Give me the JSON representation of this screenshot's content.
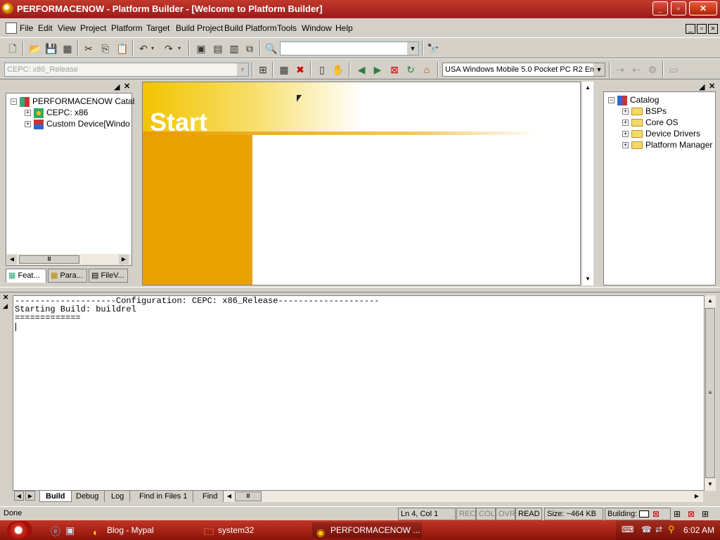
{
  "window": {
    "title": "PERFORMACENOW - Platform Builder - [Welcome to Platform Builder]",
    "minimize": "_",
    "maximize": "▫",
    "close": "✕"
  },
  "menu": [
    "File",
    "Edit",
    "View",
    "Project",
    "Platform",
    "Target",
    "Build Project",
    "Build Platform",
    "Tools",
    "Window",
    "Help"
  ],
  "toolbar": {
    "find_combo_value": "",
    "config_combo_value": "CEPC: x86_Release",
    "sdk_combo_value": "USA Windows Mobile 5.0 Pocket PC R2 Em"
  },
  "workspace": {
    "tree": [
      {
        "label": "PERFORMACENOW Catal",
        "level": 0,
        "expander": "−"
      },
      {
        "label": "CEPC: x86",
        "level": 1,
        "expander": "+"
      },
      {
        "label": "Custom Device[Windo",
        "level": 1,
        "expander": "+"
      }
    ],
    "tabs": [
      "Feat...",
      "Para...",
      "FileV..."
    ]
  },
  "welcome": {
    "heading": "Start"
  },
  "catalog": {
    "tree": [
      {
        "label": "Catalog",
        "level": 0,
        "expander": "−"
      },
      {
        "label": "BSPs",
        "level": 1,
        "expander": "+"
      },
      {
        "label": "Core OS",
        "level": 1,
        "expander": "+"
      },
      {
        "label": "Device Drivers",
        "level": 1,
        "expander": "+"
      },
      {
        "label": "Platform Manager",
        "level": 1,
        "expander": "+"
      }
    ]
  },
  "output": {
    "lines": [
      "--------------------Configuration: CEPC: x86_Release--------------------",
      "Starting Build: buildrel",
      "============="
    ],
    "tabs": [
      "Build",
      "Debug",
      "Log",
      "Find in Files 1",
      "Find"
    ],
    "active_tab": "Build"
  },
  "status": {
    "text": "Done",
    "position": "Ln 4, Col 1",
    "rec": "REC",
    "col": "COL",
    "ovr": "OVR",
    "read": "READ",
    "size": "Size: ~464 KB",
    "building": "Building:"
  },
  "taskbar": {
    "tasks": [
      "Blog - Mypal",
      "system32",
      "PERFORMACENOW ..."
    ],
    "clock": "6:02 AM"
  }
}
